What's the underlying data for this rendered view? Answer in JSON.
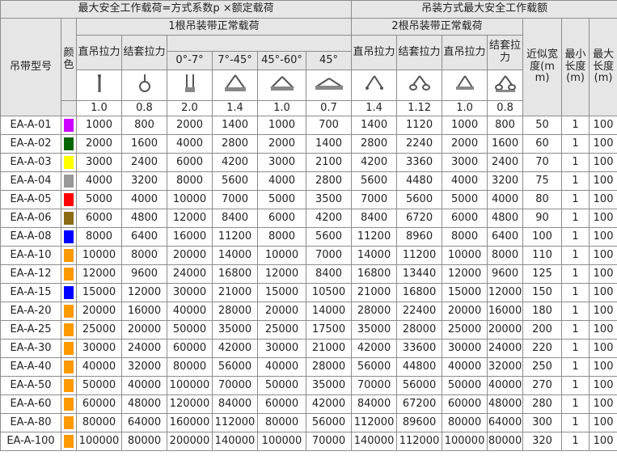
{
  "headers": {
    "top_left": "最大安全工作载荷=方式系数p ×额定载荷",
    "top_right": "吊装方式最大安全工作载额",
    "model": "吊带型号",
    "color": "颜色",
    "single": "1根吊装带正常载荷",
    "double": "2根吊装带正常载荷",
    "straight": "直吊拉力",
    "choke": "结套拉力",
    "angles": [
      "0°-7°",
      "7°-45°",
      "45°-60°",
      "45°"
    ],
    "width": "近似宽度(mm)",
    "min_len": "最小长度(m)",
    "max_len": "最大长度(m)"
  },
  "icons": [
    "straight-lift-icon",
    "choke-lift-icon",
    "basket-vertical-icon",
    "basket-7-45-icon",
    "basket-45-60-icon",
    "basket-45-icon",
    "double-straight-icon",
    "double-choke-icon",
    "double-straight-2-icon",
    "double-choke-2-icon"
  ],
  "factors": [
    "1.0",
    "0.8",
    "2.0",
    "1.4",
    "1.0",
    "0.7",
    "1.4",
    "1.12",
    "1.0",
    "0.8"
  ],
  "colors": {
    "purple": "#cc00ff",
    "green": "#006600",
    "yellow": "#ffff00",
    "grey": "#999999",
    "red": "#ff0000",
    "brown": "#8b6d14",
    "blue": "#0000ff",
    "orange": "#ff9900"
  },
  "rows": [
    {
      "model": "EA-A-01",
      "color": "purple",
      "v": [
        "1000",
        "800",
        "2000",
        "1400",
        "1000",
        "700",
        "1400",
        "1120",
        "1000",
        "800"
      ],
      "width": "50",
      "min": "1",
      "max": "100"
    },
    {
      "model": "EA-A-02",
      "color": "green",
      "v": [
        "2000",
        "1600",
        "4000",
        "2800",
        "2000",
        "1400",
        "2800",
        "2240",
        "2000",
        "1600"
      ],
      "width": "60",
      "min": "1",
      "max": "100"
    },
    {
      "model": "EA-A-03",
      "color": "yellow",
      "v": [
        "3000",
        "2400",
        "6000",
        "4200",
        "3000",
        "2100",
        "4200",
        "3360",
        "3000",
        "2400"
      ],
      "width": "70",
      "min": "1",
      "max": "100"
    },
    {
      "model": "EA-A-04",
      "color": "grey",
      "v": [
        "4000",
        "3200",
        "8000",
        "5600",
        "4000",
        "2800",
        "5600",
        "4480",
        "4000",
        "3200"
      ],
      "width": "75",
      "min": "1",
      "max": "100"
    },
    {
      "model": "EA-A-05",
      "color": "red",
      "v": [
        "5000",
        "4000",
        "10000",
        "7000",
        "5000",
        "3500",
        "7000",
        "5600",
        "5000",
        "4000"
      ],
      "width": "80",
      "min": "1",
      "max": "100"
    },
    {
      "model": "EA-A-06",
      "color": "brown",
      "v": [
        "6000",
        "4800",
        "12000",
        "8400",
        "6000",
        "4200",
        "8400",
        "6720",
        "6000",
        "4800"
      ],
      "width": "90",
      "min": "1",
      "max": "100"
    },
    {
      "model": "EA-A-08",
      "color": "blue",
      "v": [
        "8000",
        "6400",
        "16000",
        "11200",
        "8000",
        "5600",
        "11200",
        "8960",
        "8000",
        "6400"
      ],
      "width": "100",
      "min": "1",
      "max": "100"
    },
    {
      "model": "EA-A-10",
      "color": "orange",
      "v": [
        "10000",
        "8000",
        "20000",
        "14000",
        "10000",
        "7000",
        "14000",
        "11200",
        "10000",
        "8000"
      ],
      "width": "110",
      "min": "1",
      "max": "100"
    },
    {
      "model": "EA-A-12",
      "color": "orange",
      "v": [
        "12000",
        "9600",
        "24000",
        "16800",
        "12000",
        "8400",
        "16800",
        "13440",
        "12000",
        "9600"
      ],
      "width": "125",
      "min": "1",
      "max": "100"
    },
    {
      "model": "EA-A-15",
      "color": "blue",
      "v": [
        "15000",
        "12000",
        "30000",
        "21000",
        "15000",
        "10500",
        "21000",
        "16800",
        "15000",
        "12000"
      ],
      "width": "150",
      "min": "1",
      "max": "100"
    },
    {
      "model": "EA-A-20",
      "color": "orange",
      "v": [
        "20000",
        "16000",
        "40000",
        "28000",
        "20000",
        "14000",
        "28000",
        "22400",
        "20000",
        "16000"
      ],
      "width": "180",
      "min": "1",
      "max": "100"
    },
    {
      "model": "EA-A-25",
      "color": "orange",
      "v": [
        "25000",
        "20000",
        "50000",
        "35000",
        "25000",
        "17500",
        "35000",
        "28000",
        "25000",
        "20000"
      ],
      "width": "200",
      "min": "1",
      "max": "100"
    },
    {
      "model": "EA-A-30",
      "color": "orange",
      "v": [
        "30000",
        "24000",
        "60000",
        "42000",
        "30000",
        "21000",
        "42000",
        "33600",
        "30000",
        "24000"
      ],
      "width": "220",
      "min": "1",
      "max": "100"
    },
    {
      "model": "EA-A-40",
      "color": "orange",
      "v": [
        "40000",
        "32000",
        "80000",
        "56000",
        "40000",
        "28000",
        "56000",
        "44800",
        "40000",
        "32000"
      ],
      "width": "250",
      "min": "1",
      "max": "100"
    },
    {
      "model": "EA-A-50",
      "color": "orange",
      "v": [
        "50000",
        "40000",
        "100000",
        "70000",
        "50000",
        "35000",
        "70000",
        "56000",
        "50000",
        "40000"
      ],
      "width": "270",
      "min": "1",
      "max": "100"
    },
    {
      "model": "EA-A-60",
      "color": "orange",
      "v": [
        "60000",
        "48000",
        "120000",
        "84000",
        "60000",
        "42000",
        "84000",
        "67200",
        "60000",
        "48000"
      ],
      "width": "280",
      "min": "1",
      "max": "100"
    },
    {
      "model": "EA-A-80",
      "color": "orange",
      "v": [
        "80000",
        "64000",
        "160000",
        "112000",
        "80000",
        "56000",
        "112000",
        "89600",
        "80000",
        "64000"
      ],
      "width": "300",
      "min": "1",
      "max": "100"
    },
    {
      "model": "EA-A-100",
      "color": "orange",
      "v": [
        "100000",
        "80000",
        "200000",
        "140000",
        "100000",
        "70000",
        "140000",
        "112000",
        "100000",
        "80000"
      ],
      "width": "320",
      "min": "1",
      "max": "100"
    }
  ]
}
